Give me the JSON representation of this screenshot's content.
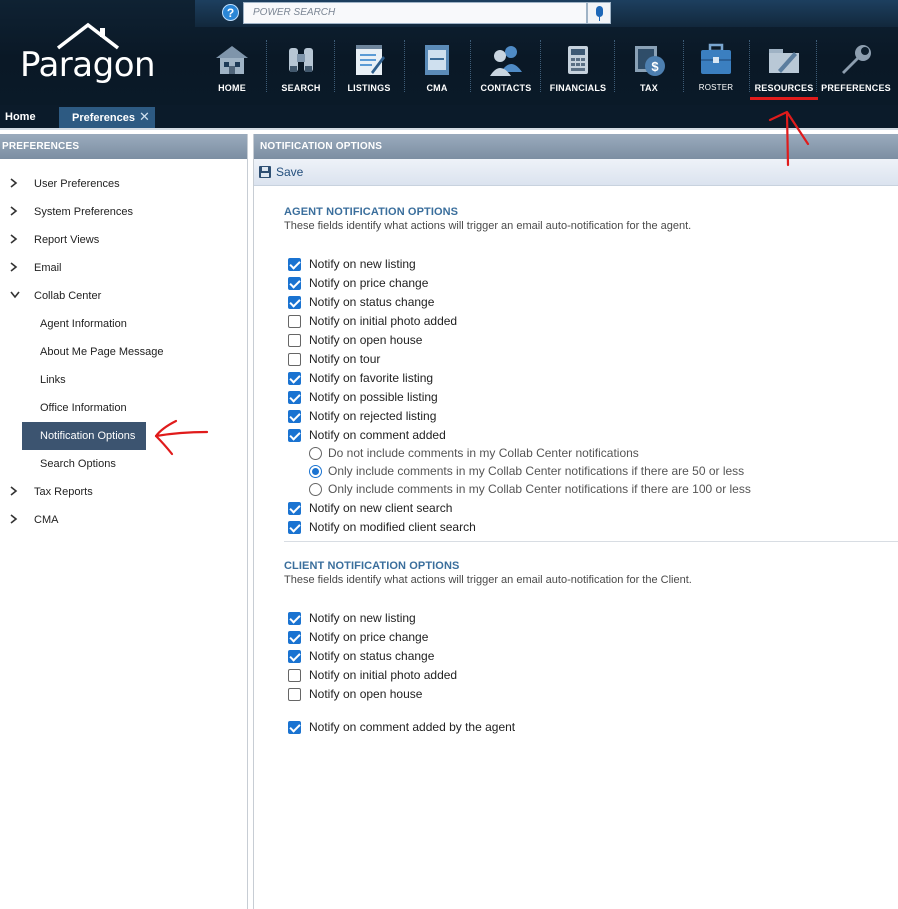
{
  "header": {
    "logo_text": "Paragon",
    "search_placeholder": "POWER SEARCH",
    "help_label": "?",
    "nav": [
      {
        "label": "HOME",
        "icon": "house-icon"
      },
      {
        "label": "SEARCH",
        "icon": "binoculars-icon"
      },
      {
        "label": "LISTINGS",
        "icon": "clipboard-icon"
      },
      {
        "label": "CMA",
        "icon": "document-icon"
      },
      {
        "label": "CONTACTS",
        "icon": "people-icon"
      },
      {
        "label": "FINANCIALS",
        "icon": "calculator-icon"
      },
      {
        "label": "TAX",
        "icon": "money-bag-icon"
      },
      {
        "label": "ROSTER",
        "icon": "briefcase-icon"
      },
      {
        "label": "RESOURCES",
        "icon": "folder-icon"
      },
      {
        "label": "PREFERENCES",
        "icon": "wrench-icon"
      }
    ],
    "highlight_color": "#e01b1b"
  },
  "tabs": {
    "home": "Home",
    "active": "Preferences",
    "close": "✕"
  },
  "left": {
    "title": "PREFERENCES",
    "items": [
      {
        "label": "User Preferences",
        "chevron": "›"
      },
      {
        "label": "System Preferences",
        "chevron": "›"
      },
      {
        "label": "Report Views",
        "chevron": "›"
      },
      {
        "label": "Email",
        "chevron": "›"
      },
      {
        "label": "Collab Center",
        "chevron": "⌄"
      },
      {
        "label": "Tax Reports",
        "chevron": "›"
      },
      {
        "label": "CMA",
        "chevron": "›"
      }
    ],
    "collab_sub": [
      "Agent Information",
      "About Me Page Message",
      "Links",
      "Office Information",
      "Notification Options",
      "Search Options"
    ],
    "selected": "Notification Options"
  },
  "main": {
    "title": "NOTIFICATION OPTIONS",
    "save_label": "Save",
    "agent": {
      "title": "AGENT NOTIFICATION OPTIONS",
      "desc": "These fields identify what actions will trigger an email auto-notification for the agent.",
      "options": [
        {
          "label": "Notify on new listing",
          "checked": true
        },
        {
          "label": "Notify on price change",
          "checked": true
        },
        {
          "label": "Notify on status change",
          "checked": true
        },
        {
          "label": "Notify on initial photo added",
          "checked": false
        },
        {
          "label": "Notify on open house",
          "checked": false
        },
        {
          "label": "Notify on tour",
          "checked": false
        },
        {
          "label": "Notify on favorite listing",
          "checked": true
        },
        {
          "label": "Notify on possible listing",
          "checked": true
        },
        {
          "label": "Notify on rejected listing",
          "checked": true
        },
        {
          "label": "Notify on comment added",
          "checked": true
        }
      ],
      "comment_radios": [
        {
          "label": "Do not include comments in my Collab Center notifications",
          "selected": false
        },
        {
          "label": "Only include comments in my Collab Center notifications if there are 50 or less",
          "selected": true
        },
        {
          "label": "Only include comments in my Collab Center notifications if there are 100 or less",
          "selected": false
        }
      ],
      "options_after": [
        {
          "label": "Notify on new client search",
          "checked": true
        },
        {
          "label": "Notify on modified client search",
          "checked": true
        }
      ]
    },
    "client": {
      "title": "CLIENT NOTIFICATION OPTIONS",
      "desc": "These fields identify what actions will trigger an email auto-notification for the Client.",
      "options": [
        {
          "label": "Notify on new listing",
          "checked": true
        },
        {
          "label": "Notify on price change",
          "checked": true
        },
        {
          "label": "Notify on status change",
          "checked": true
        },
        {
          "label": "Notify on initial photo added",
          "checked": false
        },
        {
          "label": "Notify on open house",
          "checked": false
        }
      ],
      "extra": {
        "label": "Notify on comment added by the agent",
        "checked": true
      }
    }
  }
}
